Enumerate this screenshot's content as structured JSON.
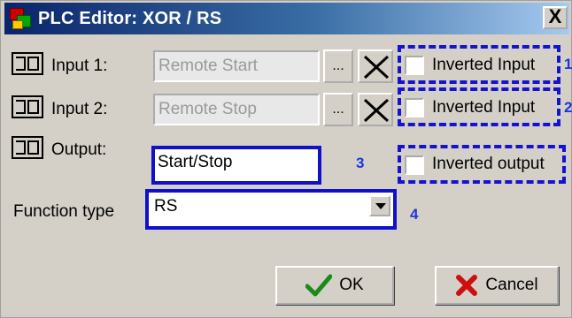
{
  "window": {
    "title": "PLC Editor: XOR / RS",
    "close_glyph": "X"
  },
  "rows": [
    {
      "label": "Input 1:",
      "value": "Remote Start",
      "dots": "...",
      "invert_label": "Inverted Input",
      "marker": "1"
    },
    {
      "label": "Input 2:",
      "value": "Remote Stop",
      "dots": "...",
      "invert_label": "Inverted Input",
      "marker": "2"
    },
    {
      "label": "Output:",
      "value": "Start/Stop",
      "invert_label": "Inverted output",
      "marker": "3"
    }
  ],
  "function_type": {
    "label": "Function type",
    "value": "RS",
    "marker": "4"
  },
  "buttons": {
    "ok": "OK",
    "cancel": "Cancel"
  },
  "icons": {
    "row": "plc-block-icon",
    "clear": "x-clear-icon",
    "ok": "checkmark-icon",
    "cancel": "red-x-icon"
  },
  "colors": {
    "highlight": "#1414d0",
    "marker": "#1a36e0"
  }
}
